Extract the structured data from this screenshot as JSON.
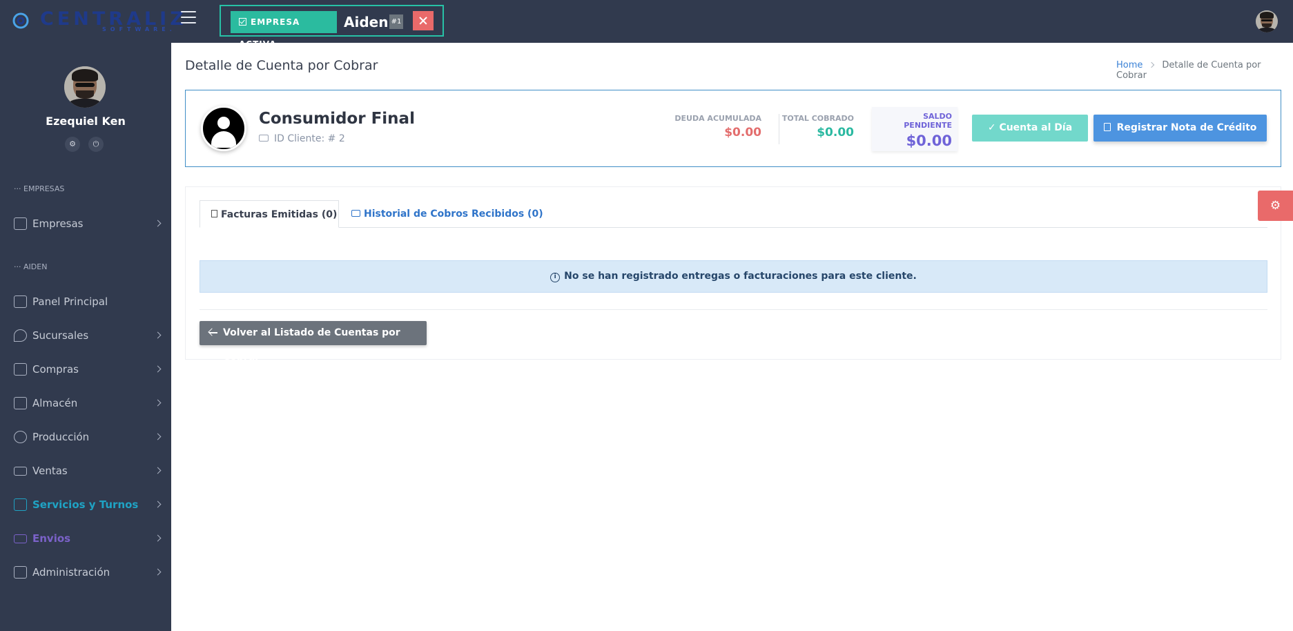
{
  "header": {
    "logo_text": "CENTRALIZ",
    "logo_subtext": "SOFTWARE.",
    "company_badge": "EMPRESA ACTIVA",
    "company_name": "Aiden",
    "company_number": "#1"
  },
  "sidebar": {
    "user_name": "Ezequiel Ken",
    "sections": {
      "empresas": "EMPRESAS",
      "aiden": "AIDEN"
    },
    "items": [
      {
        "label": "Empresas",
        "icon": "building-icon"
      },
      {
        "label": "Panel Principal",
        "icon": "home-icon"
      },
      {
        "label": "Sucursales",
        "icon": "map-pin-icon"
      },
      {
        "label": "Compras",
        "icon": "basket-icon"
      },
      {
        "label": "Almacén",
        "icon": "archive-icon"
      },
      {
        "label": "Producción",
        "icon": "gears-icon"
      },
      {
        "label": "Ventas",
        "icon": "cash-icon"
      },
      {
        "label": "Servicios y Turnos",
        "icon": "calendar-icon"
      },
      {
        "label": "Envios",
        "icon": "truck-icon"
      },
      {
        "label": "Administración",
        "icon": "wallet-icon"
      }
    ],
    "colors": {
      "active": "#1fa3c4",
      "envios": "#7b62c9"
    }
  },
  "page": {
    "title": "Detalle de Cuenta por Cobrar",
    "breadcrumb": {
      "home": "Home",
      "current": "Detalle de Cuenta por Cobrar"
    }
  },
  "client": {
    "name": "Consumidor Final",
    "id_label": "ID Cliente: # 2",
    "metrics": {
      "deuda_label": "DEUDA ACUMULADA",
      "deuda_value": "$0.00",
      "cobrado_label": "TOTAL COBRADO",
      "cobrado_value": "$0.00",
      "saldo_label": "SALDO PENDIENTE",
      "saldo_value": "$0.00"
    },
    "buttons": {
      "ok": "Cuenta al Día",
      "note": "Registrar Nota de Crédito"
    }
  },
  "tabs": {
    "facturas": "Facturas Emitidas (0)",
    "historial": "Historial de Cobros Recibidos (0)"
  },
  "alert": "No se han registrado entregas o facturaciones para este cliente.",
  "back_button": "Volver al Listado de Cuentas por Cobrar",
  "colors": {
    "header_bg": "#313a4e",
    "teal": "#2bbb9f",
    "danger": "#e96a6a",
    "primary": "#4d94e0",
    "debt": "#e36d6d",
    "paid": "#2bb9a1",
    "pending": "#6f63d8"
  }
}
